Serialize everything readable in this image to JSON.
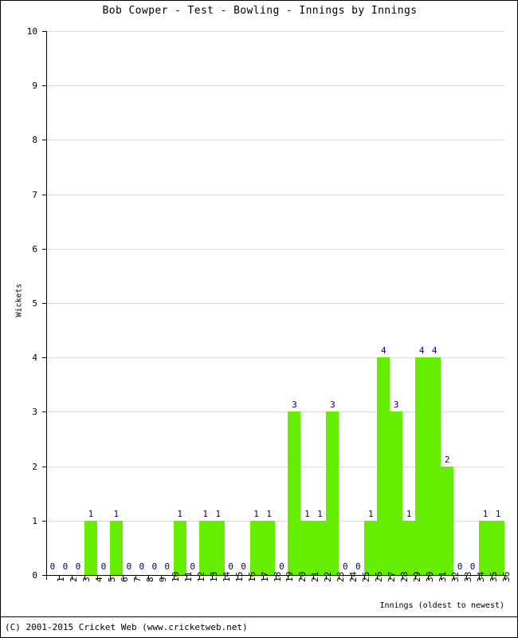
{
  "title": "Bob Cowper - Test - Bowling - Innings by Innings",
  "footer": "(C) 2001-2015 Cricket Web (www.cricketweb.net)",
  "colors": {
    "bar": "#66EE00",
    "value_label": "#000080",
    "gridline": "#DDDDDD",
    "axis": "#000000",
    "background": "#FFFFFF"
  },
  "chart_data": {
    "type": "bar",
    "title": "Bob Cowper - Test - Bowling - Innings by Innings",
    "xlabel": "Innings (oldest to newest)",
    "ylabel": "Wickets",
    "ylim": [
      0,
      10
    ],
    "yticks": [
      0,
      1,
      2,
      3,
      4,
      5,
      6,
      7,
      8,
      9,
      10
    ],
    "grid": true,
    "legend": "none",
    "categories": [
      "1",
      "2",
      "3",
      "4",
      "5",
      "6",
      "7",
      "8",
      "9",
      "10",
      "11",
      "12",
      "13",
      "14",
      "15",
      "16",
      "17",
      "18",
      "19",
      "20",
      "21",
      "22",
      "23",
      "24",
      "25",
      "26",
      "27",
      "28",
      "29",
      "30",
      "31",
      "32",
      "33",
      "34",
      "35",
      "36"
    ],
    "values": [
      0,
      0,
      0,
      1,
      0,
      1,
      0,
      0,
      0,
      0,
      1,
      0,
      1,
      1,
      0,
      0,
      1,
      1,
      0,
      3,
      1,
      1,
      3,
      0,
      0,
      1,
      4,
      3,
      1,
      4,
      4,
      2,
      0,
      0,
      1,
      1
    ],
    "series": [
      {
        "name": "Wickets",
        "values": [
          0,
          0,
          0,
          1,
          0,
          1,
          0,
          0,
          0,
          0,
          1,
          0,
          1,
          1,
          0,
          0,
          1,
          1,
          0,
          3,
          1,
          1,
          3,
          0,
          0,
          1,
          4,
          3,
          1,
          4,
          4,
          2,
          0,
          0,
          1,
          1
        ]
      }
    ]
  }
}
